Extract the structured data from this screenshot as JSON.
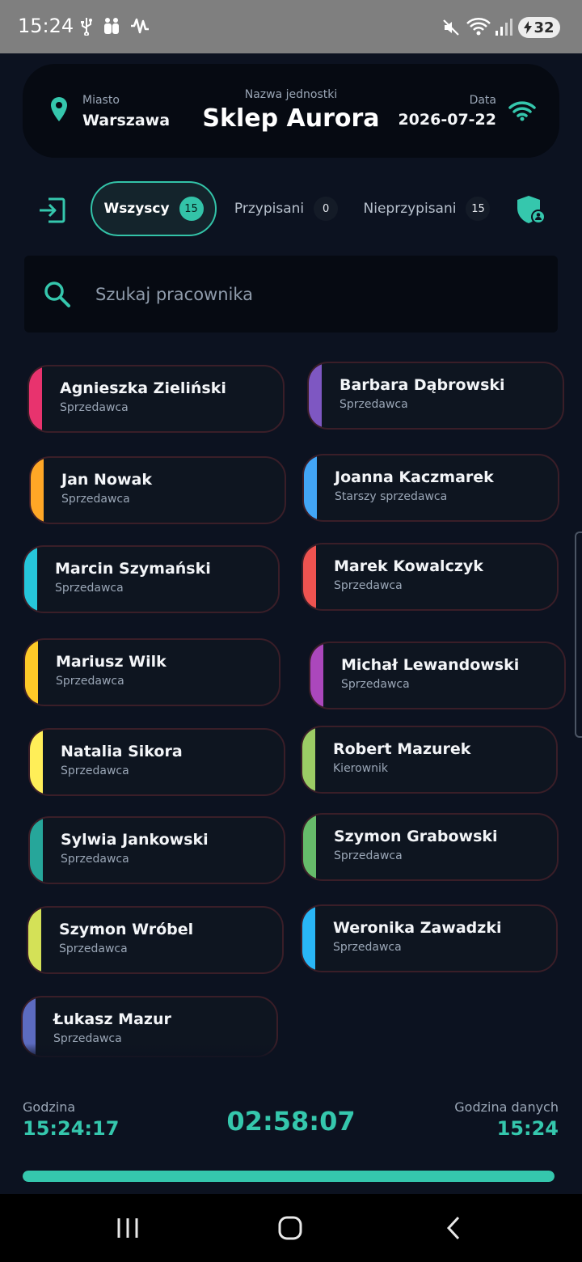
{
  "status_bar": {
    "time": "15:24",
    "battery": "32"
  },
  "header": {
    "city_label": "Miasto",
    "city": "Warszawa",
    "unit_label": "Nazwa jednostki",
    "unit": "Sklep Aurora",
    "date_label": "Data",
    "date": "2026-07-22"
  },
  "filters": {
    "all": {
      "label": "Wszyscy",
      "count": "15"
    },
    "assigned": {
      "label": "Przypisani",
      "count": "0"
    },
    "unassigned": {
      "label": "Nieprzypisani",
      "count": "15"
    }
  },
  "search": {
    "placeholder": "Szukaj pracownika"
  },
  "employees": [
    {
      "name": "Agnieszka Zieliński",
      "role": "Sprzedawca",
      "color": "#e8336e"
    },
    {
      "name": "Barbara Dąbrowski",
      "role": "Sprzedawca",
      "color": "#7e57c2"
    },
    {
      "name": "Jan Nowak",
      "role": "Sprzedawca",
      "color": "#ffa726"
    },
    {
      "name": "Joanna Kaczmarek",
      "role": "Starszy sprzedawca",
      "color": "#42a5f5"
    },
    {
      "name": "Marcin Szymański",
      "role": "Sprzedawca",
      "color": "#26c6da"
    },
    {
      "name": "Marek Kowalczyk",
      "role": "Sprzedawca",
      "color": "#ef5350"
    },
    {
      "name": "Mariusz Wilk",
      "role": "Sprzedawca",
      "color": "#ffca28"
    },
    {
      "name": "Michał Lewandowski",
      "role": "Sprzedawca",
      "color": "#ab47bc"
    },
    {
      "name": "Natalia Sikora",
      "role": "Sprzedawca",
      "color": "#ffee58"
    },
    {
      "name": "Robert Mazurek",
      "role": "Kierownik",
      "color": "#9ccc65"
    },
    {
      "name": "Sylwia Jankowski",
      "role": "Sprzedawca",
      "color": "#26a69a"
    },
    {
      "name": "Szymon Grabowski",
      "role": "Sprzedawca",
      "color": "#66bb6a"
    },
    {
      "name": "Szymon Wróbel",
      "role": "Sprzedawca",
      "color": "#d4e157"
    },
    {
      "name": "Weronika Zawadzki",
      "role": "Sprzedawca",
      "color": "#29b6f6"
    },
    {
      "name": "Łukasz Mazur",
      "role": "Sprzedawca",
      "color": "#5c6bc0"
    }
  ],
  "footer": {
    "time_label": "Godzina",
    "time": "15:24:17",
    "timer": "02:58:07",
    "data_time_label": "Godzina danych",
    "data_time": "15:24",
    "progress": 1.0
  },
  "colors": {
    "accent": "#35c7ad",
    "background": "#0c1220",
    "card": "#0e1520"
  }
}
